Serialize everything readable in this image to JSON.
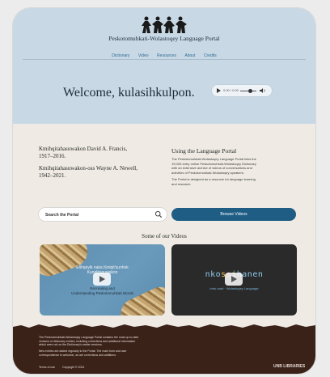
{
  "header": {
    "portal_title": "Peskotomuhkati-Wolastoqey Language Portal",
    "nav": [
      "Dictionary",
      "Video",
      "Resources",
      "About",
      "Credits"
    ]
  },
  "hero": {
    "welcome": "Welcome, kulasihkulpon.",
    "audio_time": "0:00 / 0:00"
  },
  "memorial": {
    "line1": "Kmihqitahasuwakon David A. Francis,",
    "line2": "1917–2016.",
    "line3": "Kmihqitahasuwakon-oss Wayne A. Newell,",
    "line4": "1942–2021."
  },
  "about": {
    "title": "Using the Language Portal",
    "p1_l1": "The Peskotomuhkati-Wolastoqey Language Portal links the",
    "p1_l2": "19,000-entry online Peskotomuhkati-Wolastoqey Dictionary",
    "p1_l3": "with an extensive archive of videos of conversations and",
    "p1_l4": "activities of Peskotomuhkati-Wolastoqey speakers.",
    "p2_l1": "The Portal is designed as a resource for language learning",
    "p2_l2": "and research."
  },
  "search": {
    "placeholder": "Search the Portal"
  },
  "browse_label": "Browse Videos",
  "videos_heading": "Some of our Videos",
  "videos": [
    {
      "title_l1": "Etihqeyik naka Kiniqit'sunhok",
      "title_l2": "Kunolitasuwakon",
      "sub_l1": "Recreating and",
      "sub_l2": "Understanding Peskotomuhkati Words"
    },
    {
      "title_parts": [
        "nko",
        "s",
        "s",
        "i",
        "hanen"
      ],
      "sub": "Intro card · Wolastoqey Language"
    }
  ],
  "footer": {
    "l1": "The Peskotomuhkati-Wolastoqey Language Portal contains the most up-to-date",
    "l2": "versions of dictionary entries, including corrections and additional information",
    "l3": "which were not on the Dictionary's earlier versions.",
    "l4": "New entries are added regularly to the Portal. The main form and user",
    "l5": "correspondence is welcome, as are corrections and additions.",
    "links": [
      "Terms of use",
      "Copyright © 2024"
    ],
    "logo": "UNB LIBRARIES"
  },
  "colors": {
    "hero_bg": "#c8d9e5",
    "accent": "#1f5d85",
    "footer_bg": "#3a2219"
  }
}
